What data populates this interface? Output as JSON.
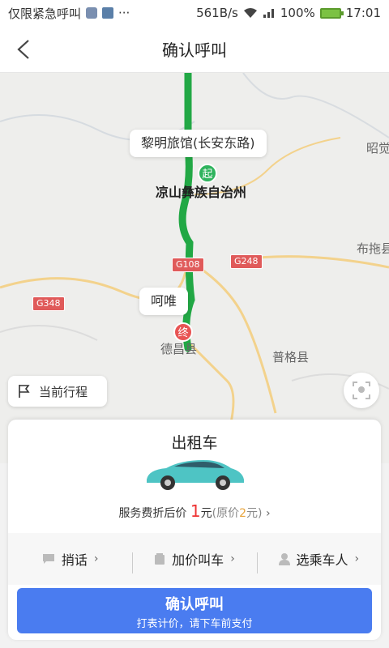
{
  "statusbar": {
    "carrier": "仅限紧急呼叫",
    "more": "···",
    "speed": "561B/s",
    "battery": "100%",
    "time": "17:01"
  },
  "titlebar": {
    "title": "确认呼叫"
  },
  "map": {
    "start_bubble": "黎明旅馆(长安东路)",
    "end_bubble": "呵唯",
    "start_pin": "起",
    "end_pin": "终",
    "labels": {
      "city": "凉山彝族自治州",
      "county_end": "德昌县",
      "puge": "普格县",
      "butuo": "布拖县",
      "zhaojue": "昭觉"
    },
    "roads": {
      "g108": "G108",
      "g248": "G248",
      "g348": "G348"
    },
    "route_color": "#22a845"
  },
  "trip_button": {
    "label": "当前行程"
  },
  "card": {
    "service": "出租车",
    "price_prefix": "服务费折后价",
    "price_value": "1",
    "price_unit": "元",
    "orig_prefix": "(原价",
    "orig_value": "2",
    "orig_suffix": "元)",
    "options": [
      {
        "label": "捎话"
      },
      {
        "label": "加价叫车"
      },
      {
        "label": "选乘车人"
      }
    ],
    "confirm_main": "确认呼叫",
    "confirm_sub": "打表计价，请下车前支付"
  },
  "colors": {
    "accent": "#4a7cf0",
    "price": "#e33333",
    "orig_price": "#e8a33a"
  }
}
